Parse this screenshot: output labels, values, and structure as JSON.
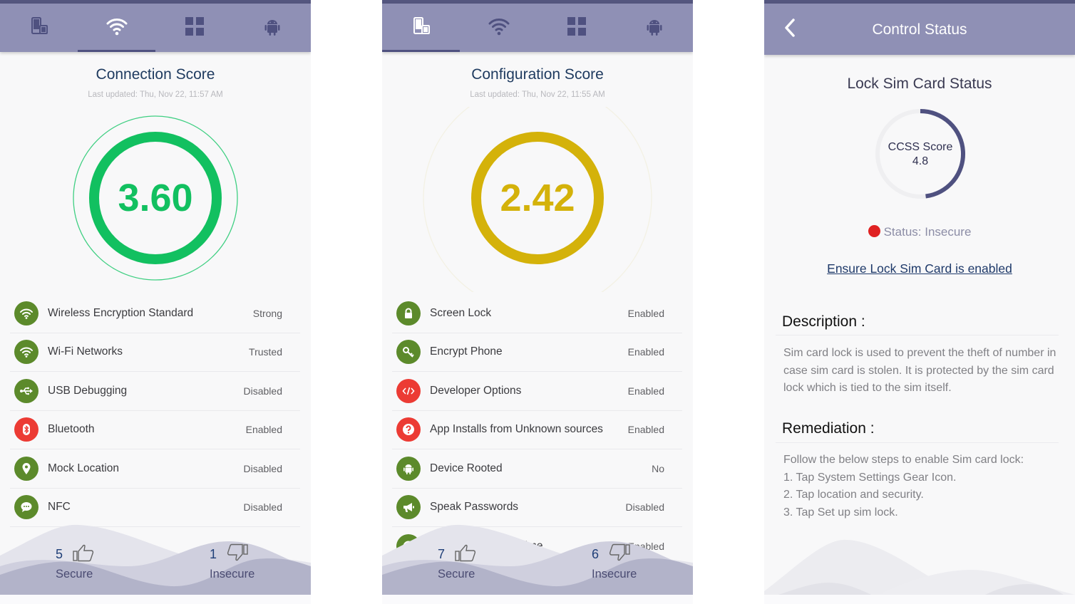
{
  "phones": [
    {
      "tabs": [
        {
          "icon": "devices-icon",
          "active": false
        },
        {
          "icon": "wifi-icon",
          "active": true
        },
        {
          "icon": "apps-grid-icon",
          "active": false
        },
        {
          "icon": "android-icon",
          "active": false
        }
      ],
      "title": "Connection Score",
      "updated": "Last updated: Thu, Nov 22, 11:57 AM",
      "score": "3.60",
      "score_color": "#12c060",
      "items": [
        {
          "icon": "wifi-icon",
          "label": "Wireless Encryption Standard",
          "value": "Strong",
          "status": "secure"
        },
        {
          "icon": "wifi-icon",
          "label": "Wi-Fi Networks",
          "value": "Trusted",
          "status": "secure"
        },
        {
          "icon": "usb-icon",
          "label": "USB Debugging",
          "value": "Disabled",
          "status": "secure"
        },
        {
          "icon": "bluetooth-icon",
          "label": "Bluetooth",
          "value": "Enabled",
          "status": "insecure"
        },
        {
          "icon": "location-pin-icon",
          "label": "Mock Location",
          "value": "Disabled",
          "status": "secure"
        },
        {
          "icon": "chat-bubble-icon",
          "label": "NFC",
          "value": "Disabled",
          "status": "secure"
        }
      ],
      "secure_count": "5",
      "insecure_count": "1",
      "secure_label": "Secure",
      "insecure_label": "Insecure"
    },
    {
      "tabs": [
        {
          "icon": "devices-icon",
          "active": true
        },
        {
          "icon": "wifi-icon",
          "active": false
        },
        {
          "icon": "apps-grid-icon",
          "active": false
        },
        {
          "icon": "android-icon",
          "active": false
        }
      ],
      "title": "Configuration Score",
      "updated": "Last updated: Thu, Nov 22, 11:55 AM",
      "score": "2.42",
      "score_color": "#d4b20a",
      "items": [
        {
          "icon": "lock-icon",
          "label": "Screen Lock",
          "value": "Enabled",
          "status": "secure"
        },
        {
          "icon": "key-icon",
          "label": "Encrypt Phone",
          "value": "Enabled",
          "status": "secure"
        },
        {
          "icon": "code-icon",
          "label": "Developer Options",
          "value": "Enabled",
          "status": "insecure"
        },
        {
          "icon": "question-icon",
          "label": "App Installs from Unknown sources",
          "value": "Enabled",
          "status": "insecure"
        },
        {
          "icon": "android-icon",
          "label": "Device Rooted",
          "value": "No",
          "status": "secure"
        },
        {
          "icon": "megaphone-icon",
          "label": "Speak Passwords",
          "value": "Disabled",
          "status": "secure"
        },
        {
          "icon": "clock-icon",
          "label": "Automatic Date & Time",
          "value": "Enabled",
          "status": "secure"
        }
      ],
      "secure_count": "7",
      "insecure_count": "6",
      "secure_label": "Secure",
      "insecure_label": "Insecure"
    }
  ],
  "control": {
    "title": "Control Status",
    "heading": "Lock Sim Card Status",
    "ccss_label": "CCSS Score",
    "ccss_value": "4.8",
    "ccss_fraction": 0.48,
    "status": "Status: Insecure",
    "status_color": "#e02222",
    "link": "Ensure Lock Sim Card is enabled",
    "description_title": "Description :",
    "description": "Sim card lock is used to prevent the theft of number in case sim card is stolen. It is protected by the sim card lock which is tied to the sim itself.",
    "remediation_title": "Remediation :",
    "remediation_lines": [
      "Follow the below steps to enable Sim card lock:",
      "1. Tap System Settings Gear Icon.",
      "2. Tap location and security.",
      "3. Tap Set up sim lock."
    ]
  },
  "colors": {
    "appbar": "#8f90b5",
    "statusbar": "#54567f",
    "secure_icon": "#5c8a2b",
    "insecure_icon": "#ec3b34",
    "ccss_arc": "#4f5180"
  }
}
